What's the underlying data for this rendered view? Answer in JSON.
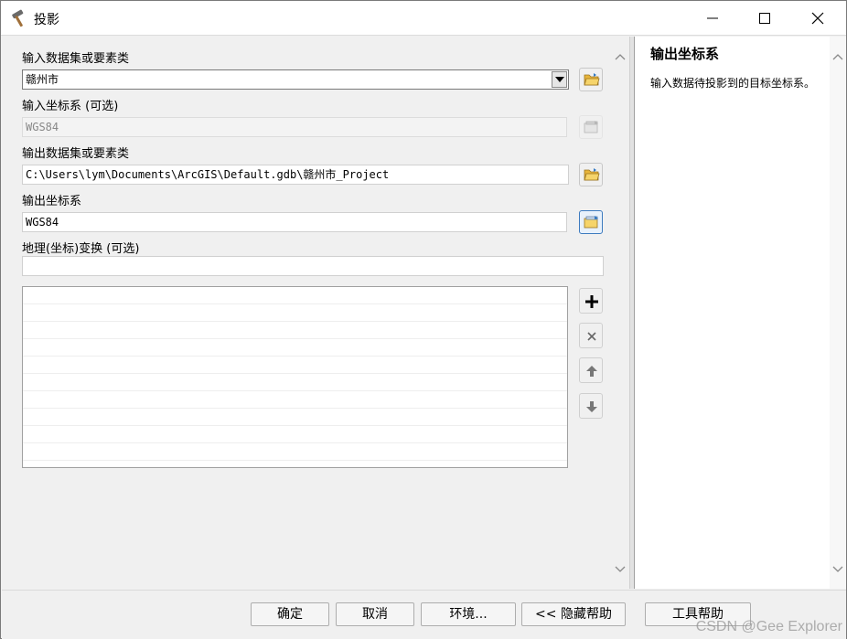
{
  "window": {
    "title": "投影",
    "icon": "hammer-icon"
  },
  "form": {
    "input_dataset": {
      "label": "输入数据集或要素类",
      "value": "赣州市"
    },
    "input_crs": {
      "label": "输入坐标系 (可选)",
      "value": "WGS84"
    },
    "output_dataset": {
      "label": "输出数据集或要素类",
      "value": "C:\\Users\\lym\\Documents\\ArcGIS\\Default.gdb\\赣州市_Project"
    },
    "output_crs": {
      "label": "输出坐标系",
      "value": "WGS84"
    },
    "geo_transform": {
      "label": "地理(坐标)变换 (可选)",
      "value": ""
    }
  },
  "help": {
    "title": "输出坐标系",
    "text": "输入数据待投影到的目标坐标系。"
  },
  "buttons": {
    "ok": "确定",
    "cancel": "取消",
    "environments": "环境...",
    "hide_help": "<< 隐藏帮助",
    "tool_help": "工具帮助"
  },
  "watermark": "CSDN @Gee Explorer",
  "colors": {
    "accent": "#3d7bbf",
    "folder": "#e8b53a"
  }
}
